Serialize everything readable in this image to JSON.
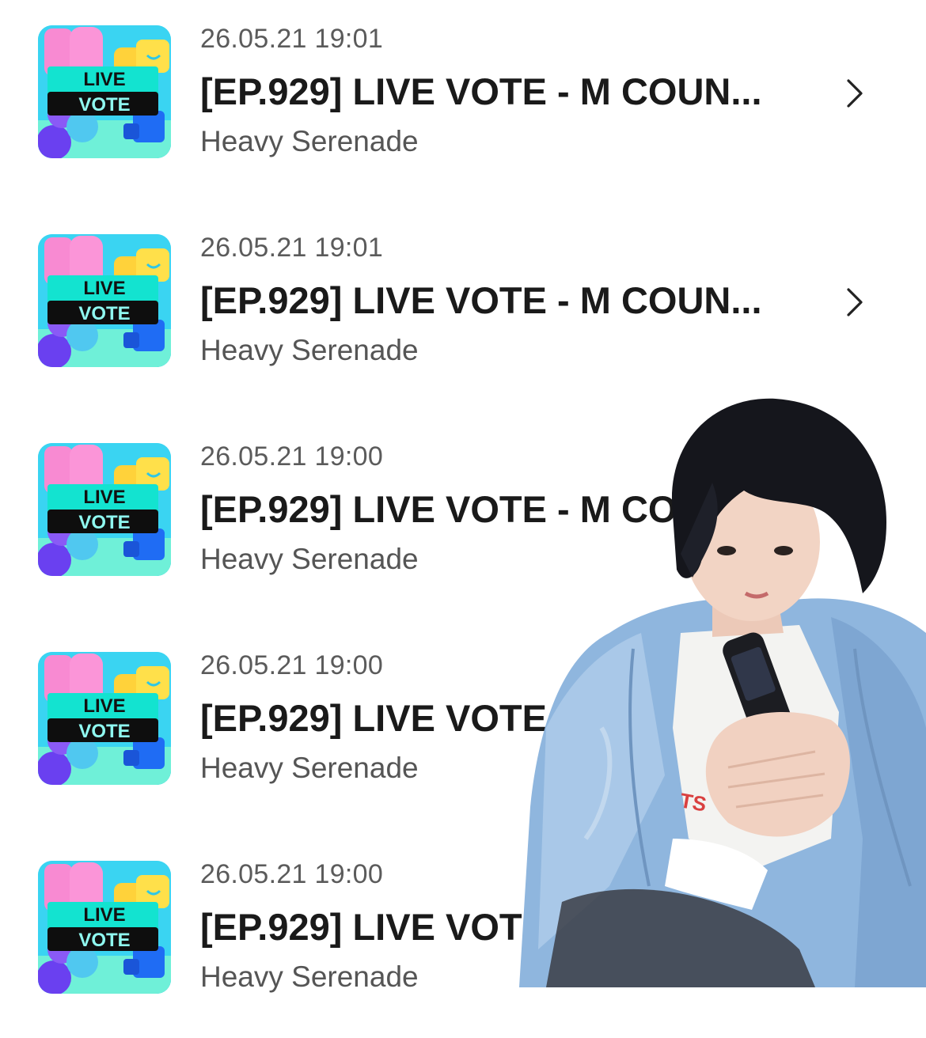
{
  "list": {
    "items": [
      {
        "time": "26.05.21 19:01",
        "title": "[EP.929] LIVE VOTE - M COUN...",
        "artist": "Heavy Serenade",
        "thumb_text": [
          "LIVE",
          "VOTE"
        ],
        "chevron": "chevron-right-icon"
      },
      {
        "time": "26.05.21 19:01",
        "title": "[EP.929] LIVE VOTE - M COUN...",
        "artist": "Heavy Serenade",
        "thumb_text": [
          "LIVE",
          "VOTE"
        ],
        "chevron": "chevron-right-icon"
      },
      {
        "time": "26.05.21 19:00",
        "title": "[EP.929] LIVE VOTE - M COUN...",
        "artist": "Heavy Serenade",
        "thumb_text": [
          "LIVE",
          "VOTE"
        ],
        "chevron": "chevron-right-icon"
      },
      {
        "time": "26.05.21 19:00",
        "title": "[EP.929] LIVE VOTE - M COUN...",
        "artist": "Heavy Serenade",
        "thumb_text": [
          "LIVE",
          "VOTE"
        ],
        "chevron": "chevron-right-icon"
      },
      {
        "time": "26.05.21 19:00",
        "title": "[EP.929] LIVE VOTE - M COUN...",
        "artist": "Heavy Serenade",
        "thumb_text": [
          "LIVE",
          "VOTE"
        ],
        "chevron": "chevron-right-icon"
      }
    ]
  },
  "overlay": {
    "description_icon": "person-photo",
    "shirt_text": "TS"
  },
  "colors": {
    "title": "#1a1a1a",
    "time": "#5b5b5b",
    "artist": "#555555",
    "thumb_bg": "#3ad4f2",
    "thumb_badge": "#0e0e0e",
    "jacket": "#8fb4dc",
    "hair": "#15161c"
  }
}
